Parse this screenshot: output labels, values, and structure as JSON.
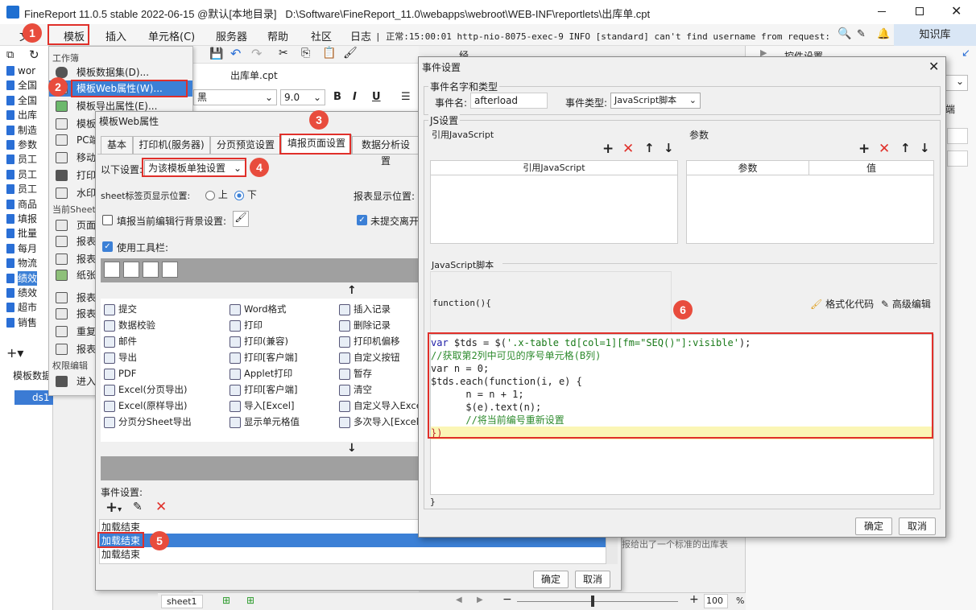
{
  "titlebar": {
    "title": "FineReport 11.0.5 stable 2022-06-15 @默认[本地目录]   D:\\Software\\FineReport_11.0\\webapps\\webroot\\WEB-INF\\reportlets\\出库单.cpt"
  },
  "menubar": {
    "items": [
      "文",
      "模板",
      "插入",
      "单元格(C)",
      "服务器",
      "帮助",
      "社区",
      "日志"
    ],
    "log": "| 正常:15:00:01 http-nio-8075-exec-9 INFO [standard] can't find username from request: Login...",
    "knowledge": "知识库"
  },
  "left_tree": [
    "wor",
    "全国",
    "全国",
    "出库",
    "制造",
    "参数",
    "员工",
    "员工",
    "员工",
    "商品",
    "填报",
    "批量",
    "每月",
    "物流",
    "绩效",
    "绩效",
    "超市",
    "销售"
  ],
  "left_bottom": {
    "label": "模板数据",
    "ds": "ds1"
  },
  "dropmenu": {
    "section1": "工作簿",
    "items": [
      "模板数据集(D)...",
      "模板Web属性(W)...",
      "模板导出属性(E)...",
      "模板",
      "PC端",
      "移动",
      "打印",
      "水印"
    ],
    "section2": "当前Sheet",
    "items2": [
      "页面",
      "报表",
      "报表",
      "纸张"
    ],
    "items3": [
      "报表",
      "报表",
      "重复",
      "报表"
    ],
    "section3": "权限编辑",
    "items4": [
      "进入"
    ]
  },
  "center": {
    "tab": "出库单.cpt",
    "font": "黑",
    "size": "9.0",
    "classic": "经典字"
  },
  "rightpanel": {
    "title": "控件设置",
    "tab": "端"
  },
  "webdlg": {
    "title": "模板Web属性",
    "tabs": [
      "基本",
      "打印机(服务器)",
      "分页预览设置",
      "填报页面设置",
      "数据分析设置"
    ],
    "settings_label": "以下设置:",
    "settings_value": "为该模板单独设置",
    "sheet_pos_label": "sheet标签页显示位置:",
    "pos_top": "上",
    "pos_bottom": "下",
    "report_pos_label": "报表显示位置:",
    "bg_label": "填报当前编辑行背景设置:",
    "unsubmitted": "未提交离开",
    "use_toolbar": "使用工具栏:",
    "buttons": [
      [
        "提交",
        "Word格式",
        "插入记录"
      ],
      [
        "数据校验",
        "打印",
        "删除记录"
      ],
      [
        "邮件",
        "打印(兼容)",
        "打印机偏移"
      ],
      [
        "导出",
        "打印[客户端]",
        "自定义按钮"
      ],
      [
        "PDF",
        "Applet打印",
        "暂存"
      ],
      [
        "Excel(分页导出)",
        "打印[客户端]",
        "清空"
      ],
      [
        "Excel(原样导出)",
        "导入[Excel]",
        "自定义导入Excel"
      ],
      [
        "分页分Sheet导出",
        "显示单元格值",
        "多次导入[Excel]"
      ]
    ],
    "events_label": "事件设置:",
    "events": [
      "加载结束",
      "加载结束",
      "加载结束"
    ],
    "ok": "确定",
    "cancel": "取消"
  },
  "evdlg": {
    "title": "事件设置",
    "name_type_section": "事件名字和类型",
    "name_label": "事件名:",
    "name_value": "afterload",
    "type_label": "事件类型:",
    "type_value": "JavaScript脚本",
    "js_section": "JS设置",
    "ref_js": "引用JavaScript",
    "params": "参数",
    "ref_js_col": "引用JavaScript",
    "param_col": "参数",
    "value_col": "值",
    "js_script": "JavaScript脚本",
    "func_header": "function(){",
    "format_code": "格式化代码",
    "advanced_edit": "高级编辑",
    "code": [
      "var $tds = $('.x-table td[col=1][fm=\"SEQ()\"]:visible');",
      "//获取第2列中可见的序号单元格(B列)",
      "var n = 0;",
      "$tds.each(function(i, e) {",
      "      n = n + 1;",
      "      $(e).text(n);",
      "      //将当前编号重新设置",
      "})"
    ],
    "func_footer": "}",
    "ok": "确定",
    "cancel": "取消"
  },
  "bottom": {
    "sheet": "sheet1",
    "zoom": "100",
    "pct": "%",
    "hint": "报给出了一个标准的出库表"
  },
  "badges": [
    "1",
    "2",
    "3",
    "4",
    "5",
    "6"
  ]
}
